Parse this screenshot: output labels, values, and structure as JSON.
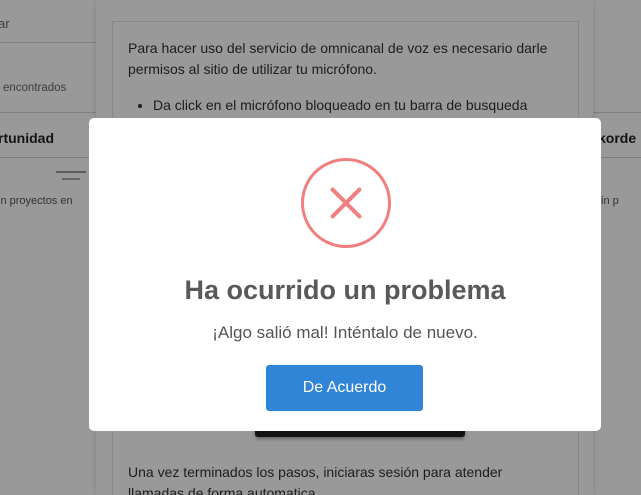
{
  "background": {
    "search_fragment": "ar",
    "results_label": "encontrados",
    "column_left_header": "rtunidad",
    "column_right_header": "korde",
    "empty_left": "in proyectos en",
    "empty_right": "in p"
  },
  "permissions_panel": {
    "intro": "Para hacer uso del servicio de omnicanal de voz es necesario darle permisos al sitio de utilizar tu micrófono.",
    "steps": [
      "Da click en el micrófono bloqueado en tu barra de busqueda"
    ],
    "footer": "Una vez terminados los pasos, iniciaras sesión para atender llamadas de forma automatica."
  },
  "alert": {
    "icon": "error-x-icon",
    "title": "Ha ocurrido un problema",
    "text": "¡Algo salió mal! Inténtalo de nuevo.",
    "confirm_label": "De Acuerdo",
    "colors": {
      "icon": "#f07f7f",
      "button": "#3085d6",
      "overlay": "rgba(0,0,0,0.40)"
    }
  }
}
